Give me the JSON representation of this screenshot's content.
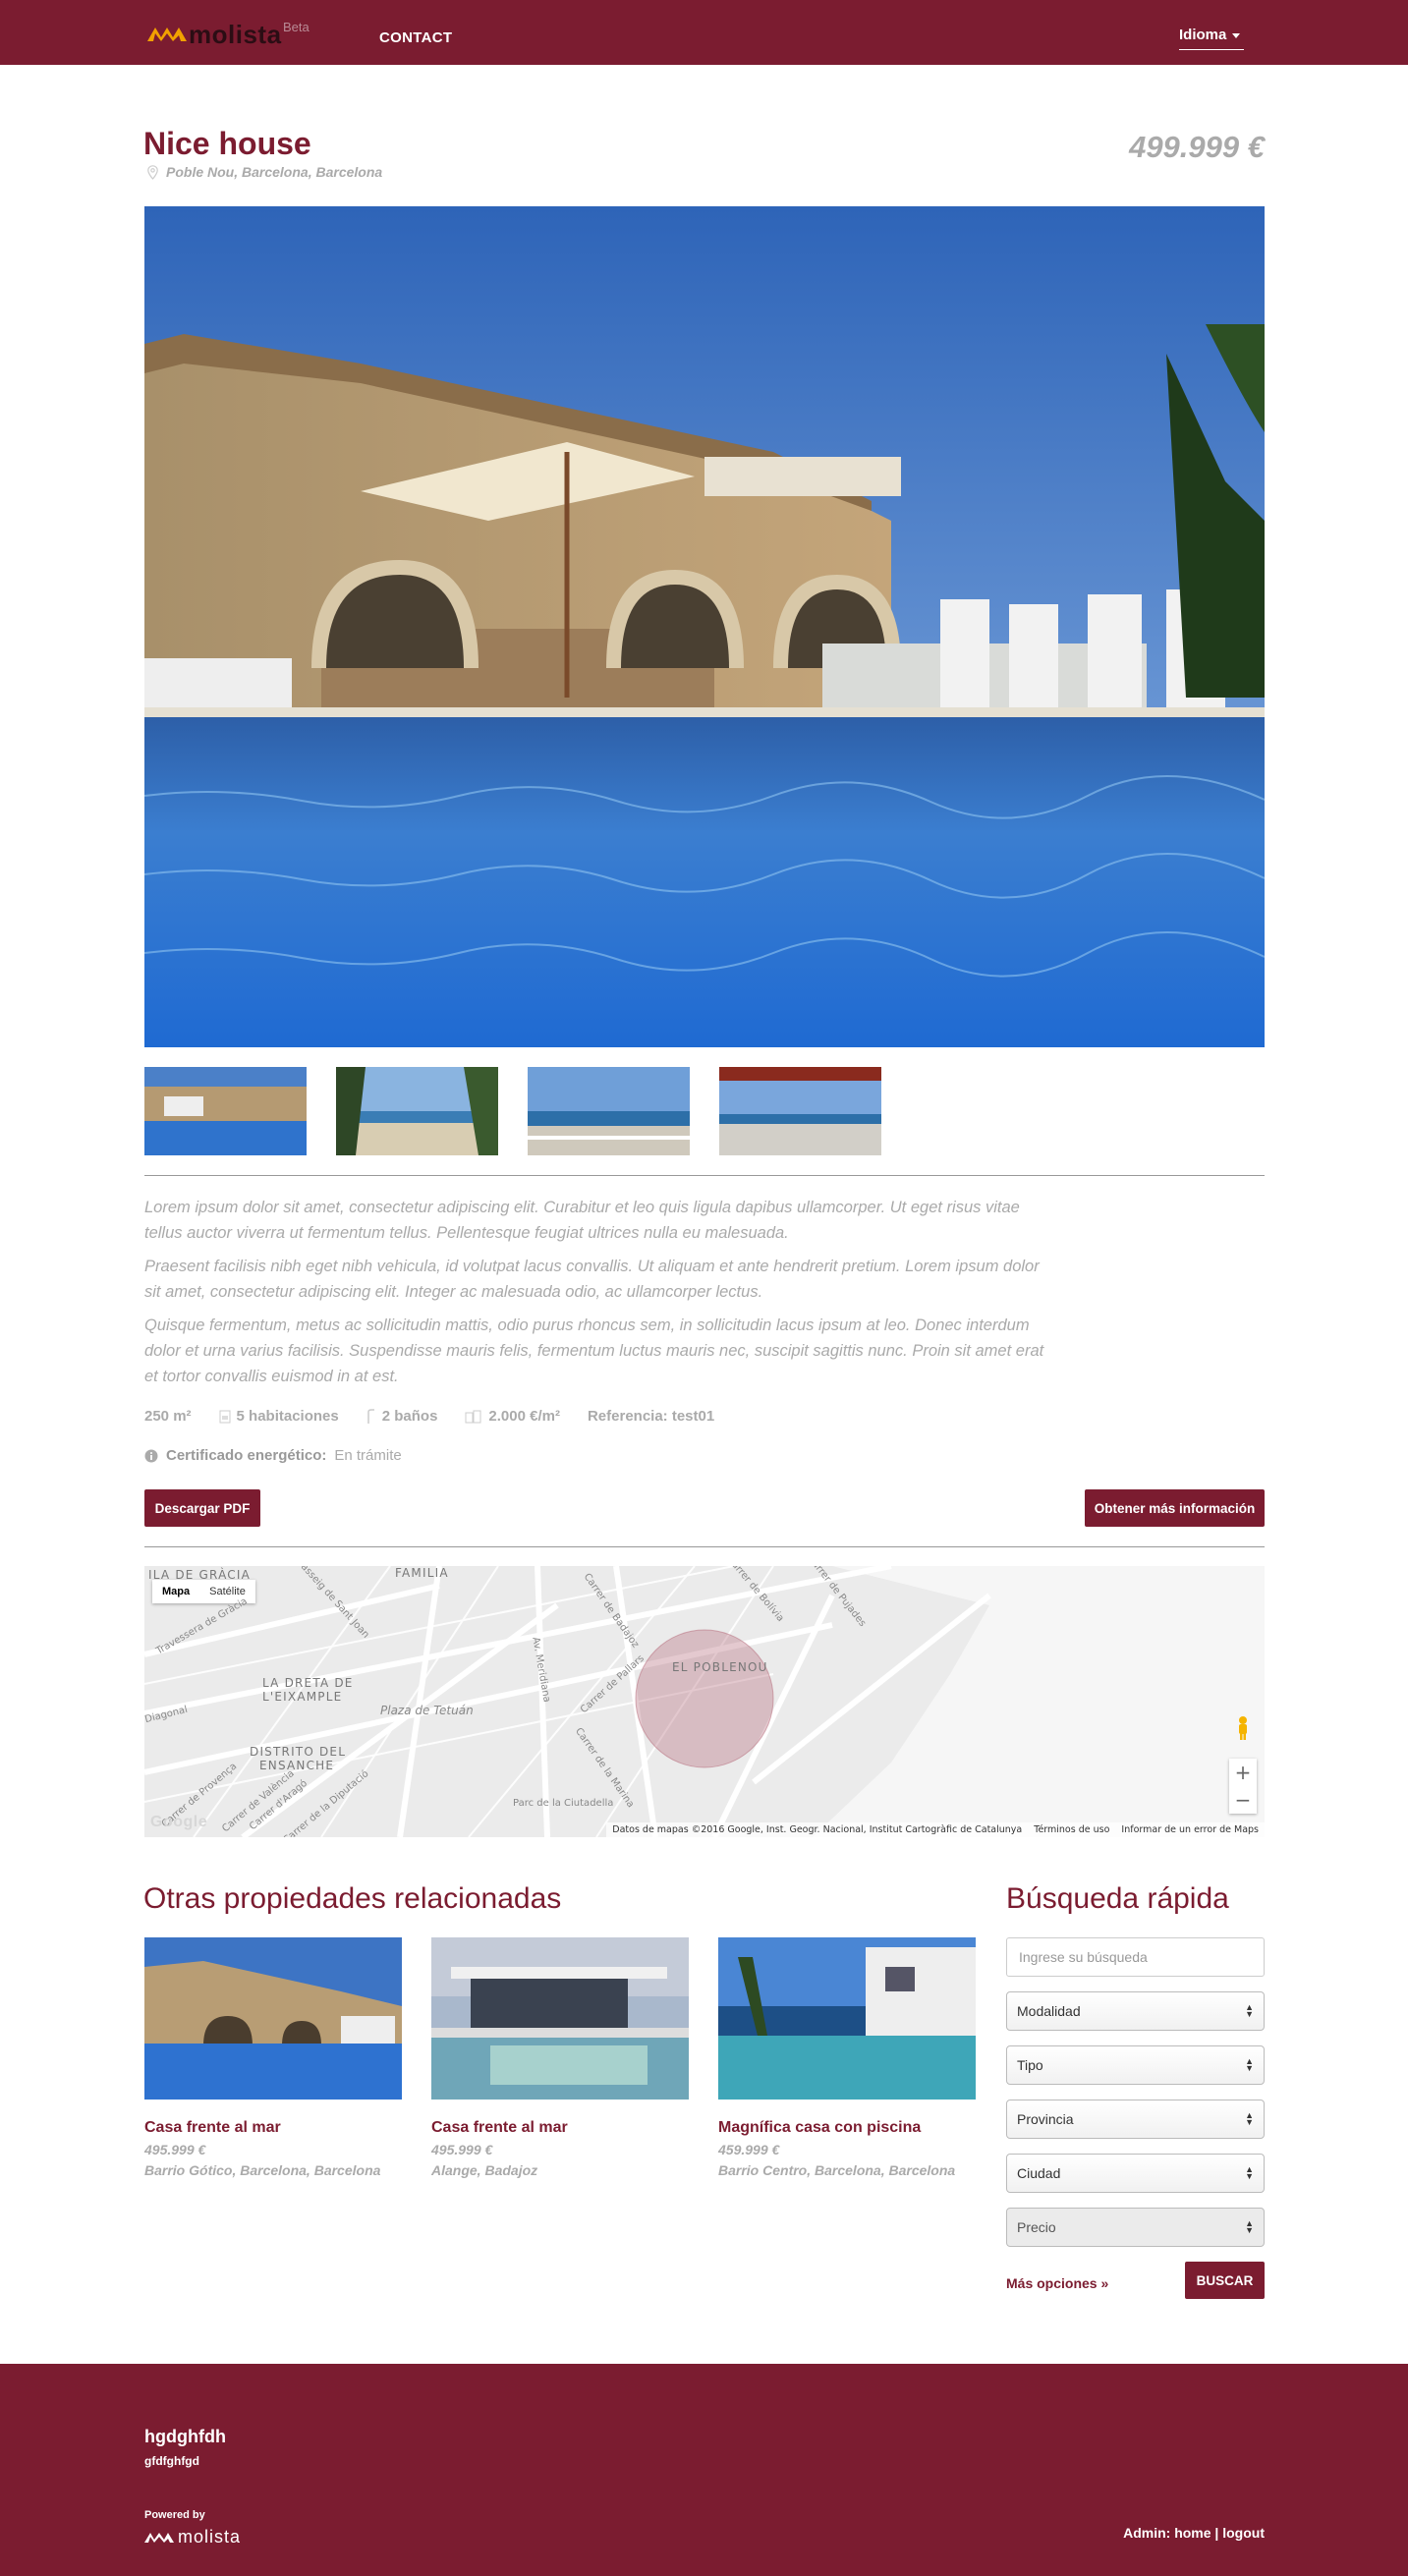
{
  "header": {
    "logo_text": "molista",
    "logo_badge": "Beta",
    "nav_contact": "CONTACT",
    "language_label": "Idioma"
  },
  "property": {
    "title": "Nice house",
    "location": "Poble Nou, Barcelona, Barcelona",
    "price": "499.999 €",
    "description": [
      "Lorem ipsum dolor sit amet, consectetur adipiscing elit. Curabitur et leo quis ligula dapibus ullamcorper. Ut eget risus vitae tellus auctor viverra ut fermentum tellus. Pellentesque feugiat ultrices nulla eu malesuada.",
      "Praesent facilisis nibh eget nibh vehicula, id volutpat lacus convallis. Ut aliquam et ante hendrerit pretium. Lorem ipsum dolor sit amet, consectetur adipiscing elit. Integer ac malesuada odio, ac ullamcorper lectus.",
      "Quisque fermentum, metus ac sollicitudin mattis, odio purus rhoncus sem, in sollicitudin lacus ipsum at leo. Donec interdum dolor et urna varius facilisis. Suspendisse mauris felis, fermentum luctus mauris nec, suscipit sagittis nunc. Proin sit amet erat et tortor convallis euismod in at est."
    ],
    "features": {
      "area": "250 m²",
      "rooms": "5 habitaciones",
      "baths": "2 baños",
      "price_m2": "2.000 €/m²",
      "reference": "Referencia: test01"
    },
    "energy_label": "Certificado energético:",
    "energy_value": "En trámite",
    "pdf_button": "Descargar PDF",
    "info_button": "Obtener más información"
  },
  "map": {
    "tab_map": "Mapa",
    "tab_satellite": "Satélite",
    "areas": [
      "FAMILIA",
      "LA DRETA DE",
      "L'EIXAMPLE",
      "DISTRITO DEL",
      "ENSANCHE",
      "EL POBLENOU",
      "ILA DE GRÀCIA"
    ],
    "streets": [
      "Plaza de Tetuán",
      "Passeig de Sant Joan",
      "Carrer de Badajoz",
      "Carrer de Pallars",
      "Av. Meridiana",
      "Carrer de la Marina",
      "Parc de la Ciutadella",
      "Diagonal",
      "Carrer de Provença",
      "Carrer de València",
      "Carrer d'Aragó",
      "Carrer de Bolívia",
      "Carrer de Badajoz",
      "Travessera de Gràcia",
      "Carrer de la Diputació",
      "Carrer de Pujades"
    ],
    "attribution": "Datos de mapas ©2016 Google, Inst. Geogr. Nacional, Institut Cartogràfic de Catalunya",
    "terms": "Términos de uso",
    "report": "Informar de un error de Maps",
    "google": "Google"
  },
  "related": {
    "heading": "Otras propiedades relacionadas",
    "items": [
      {
        "title": "Casa frente al mar",
        "price": "495.999 €",
        "location": "Barrio Gótico, Barcelona, Barcelona"
      },
      {
        "title": "Casa frente al mar",
        "price": "495.999 €",
        "location": "Alange, Badajoz"
      },
      {
        "title": "Magnífica casa con piscina",
        "price": "459.999 €",
        "location": "Barrio Centro, Barcelona, Barcelona"
      }
    ]
  },
  "quick_search": {
    "heading": "Búsqueda rápida",
    "placeholder": "Ingrese su búsqueda",
    "selects": [
      "Modalidad",
      "Tipo",
      "Provincia",
      "Ciudad",
      "Precio"
    ],
    "more_options": "Más opciones »",
    "search_button": "BUSCAR"
  },
  "footer": {
    "title": "hgdghfdh",
    "subtitle": "gfdfghfgd",
    "powered_by": "Powered by",
    "logo_text": "molista",
    "admin_label": "Admin:",
    "home_link": "home",
    "separator": "|",
    "logout_link": "logout"
  },
  "colors": {
    "brand": "#7b1c30",
    "muted_text": "#aaaaaa"
  }
}
